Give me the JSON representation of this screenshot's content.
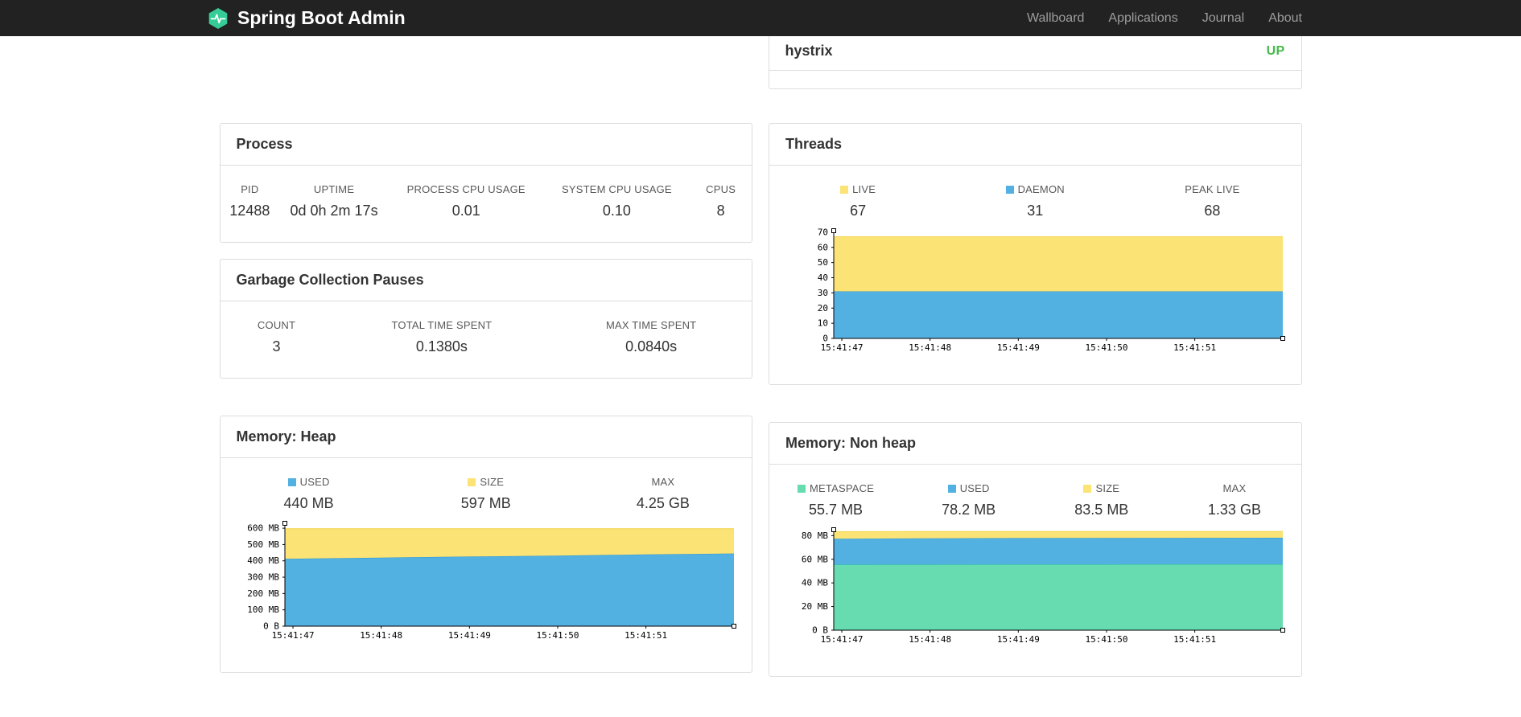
{
  "navbar": {
    "brand": "Spring Boot Admin",
    "brand_color": "#35cc97",
    "background": "#222222",
    "links": [
      {
        "label": "Wallboard"
      },
      {
        "label": "Applications"
      },
      {
        "label": "Journal"
      },
      {
        "label": "About"
      }
    ]
  },
  "health": {
    "rows": [
      {
        "name": "hystrix",
        "status": "UP",
        "status_color": "#44b949"
      }
    ]
  },
  "panels": {
    "process": {
      "title": "Process",
      "stats": [
        {
          "label": "PID",
          "value": "12488"
        },
        {
          "label": "UPTIME",
          "value": "0d 0h 2m 17s"
        },
        {
          "label": "PROCESS CPU USAGE",
          "value": "0.01"
        },
        {
          "label": "SYSTEM CPU USAGE",
          "value": "0.10"
        },
        {
          "label": "CPUS",
          "value": "8"
        }
      ]
    },
    "gc": {
      "title": "Garbage Collection Pauses",
      "stats": [
        {
          "label": "COUNT",
          "value": "3"
        },
        {
          "label": "TOTAL TIME SPENT",
          "value": "0.1380s"
        },
        {
          "label": "MAX TIME SPENT",
          "value": "0.0840s"
        }
      ]
    },
    "threads": {
      "title": "Threads",
      "stats": [
        {
          "label": "LIVE",
          "value": "67",
          "swatch": "#fbe375"
        },
        {
          "label": "DAEMON",
          "value": "31",
          "swatch": "#53b1e2"
        },
        {
          "label": "PEAK LIVE",
          "value": "68"
        }
      ]
    },
    "heap": {
      "title": "Memory: Heap",
      "stats": [
        {
          "label": "USED",
          "value": "440 MB",
          "swatch": "#53b1e2"
        },
        {
          "label": "SIZE",
          "value": "597 MB",
          "swatch": "#fbe375"
        },
        {
          "label": "MAX",
          "value": "4.25 GB"
        }
      ]
    },
    "nonheap": {
      "title": "Memory: Non heap",
      "stats": [
        {
          "label": "METASPACE",
          "value": "55.7 MB",
          "swatch": "#68dcb1"
        },
        {
          "label": "USED",
          "value": "78.2 MB",
          "swatch": "#53b1e2"
        },
        {
          "label": "SIZE",
          "value": "83.5 MB",
          "swatch": "#fbe375"
        },
        {
          "label": "MAX",
          "value": "1.33 GB"
        }
      ]
    }
  },
  "chart_data": [
    {
      "id": "threads",
      "type": "area",
      "stacked": true,
      "title": "Threads",
      "x": [
        "15:41:47",
        "15:41:48",
        "15:41:49",
        "15:41:50",
        "15:41:51"
      ],
      "ylim": [
        0,
        71
      ],
      "grid": false,
      "legend_position": "top",
      "yticks": [
        {
          "v": 0,
          "label": "0"
        },
        {
          "v": 10,
          "label": "10"
        },
        {
          "v": 20,
          "label": "20"
        },
        {
          "v": 30,
          "label": "30"
        },
        {
          "v": 40,
          "label": "40"
        },
        {
          "v": 50,
          "label": "50"
        },
        {
          "v": 60,
          "label": "60"
        },
        {
          "v": 70,
          "label": "70"
        }
      ],
      "series": [
        {
          "name": "DAEMON",
          "color": "#53b1e2",
          "stroke": "#2b96d3",
          "values": [
            31,
            31,
            31,
            31,
            31,
            31
          ]
        },
        {
          "name": "LIVE",
          "color": "#fbe375",
          "stroke": "#f4d44c",
          "values": [
            67,
            67,
            67,
            67,
            67,
            67
          ]
        }
      ]
    },
    {
      "id": "heap",
      "type": "area",
      "stacked": true,
      "title": "Memory: Heap",
      "x": [
        "15:41:47",
        "15:41:48",
        "15:41:49",
        "15:41:50",
        "15:41:51"
      ],
      "ylim": [
        0,
        630
      ],
      "grid": false,
      "legend_position": "top",
      "yticks": [
        {
          "v": 0,
          "label": "0 B"
        },
        {
          "v": 100,
          "label": "100 MB"
        },
        {
          "v": 200,
          "label": "200 MB"
        },
        {
          "v": 300,
          "label": "300 MB"
        },
        {
          "v": 400,
          "label": "400 MB"
        },
        {
          "v": 500,
          "label": "500 MB"
        },
        {
          "v": 600,
          "label": "600 MB"
        }
      ],
      "series": [
        {
          "name": "USED",
          "color": "#53b1e2",
          "stroke": "#2b96d3",
          "values": [
            413,
            420,
            426,
            432,
            439,
            445
          ]
        },
        {
          "name": "SIZE",
          "color": "#fbe375",
          "stroke": "#f4d44c",
          "values": [
            597,
            597,
            597,
            597,
            597,
            597
          ]
        }
      ]
    },
    {
      "id": "nonheap",
      "type": "area",
      "stacked": true,
      "title": "Memory: Non heap",
      "x": [
        "15:41:47",
        "15:41:48",
        "15:41:49",
        "15:41:50",
        "15:41:51"
      ],
      "ylim": [
        0,
        85
      ],
      "grid": false,
      "legend_position": "top",
      "yticks": [
        {
          "v": 0,
          "label": "0 B"
        },
        {
          "v": 20,
          "label": "20 MB"
        },
        {
          "v": 40,
          "label": "40 MB"
        },
        {
          "v": 60,
          "label": "60 MB"
        },
        {
          "v": 80,
          "label": "80 MB"
        }
      ],
      "series": [
        {
          "name": "METASPACE",
          "color": "#68dcb1",
          "stroke": "#2ec98e",
          "values": [
            55.4,
            55.5,
            55.6,
            55.6,
            55.7,
            55.7
          ]
        },
        {
          "name": "USED",
          "color": "#53b1e2",
          "stroke": "#2b96d3",
          "values": [
            77.4,
            77.7,
            77.9,
            78.0,
            78.1,
            78.2
          ]
        },
        {
          "name": "SIZE",
          "color": "#fbe375",
          "stroke": "#f4d44c",
          "values": [
            83.4,
            83.5,
            83.5,
            83.5,
            83.5,
            83.5
          ]
        }
      ]
    }
  ]
}
